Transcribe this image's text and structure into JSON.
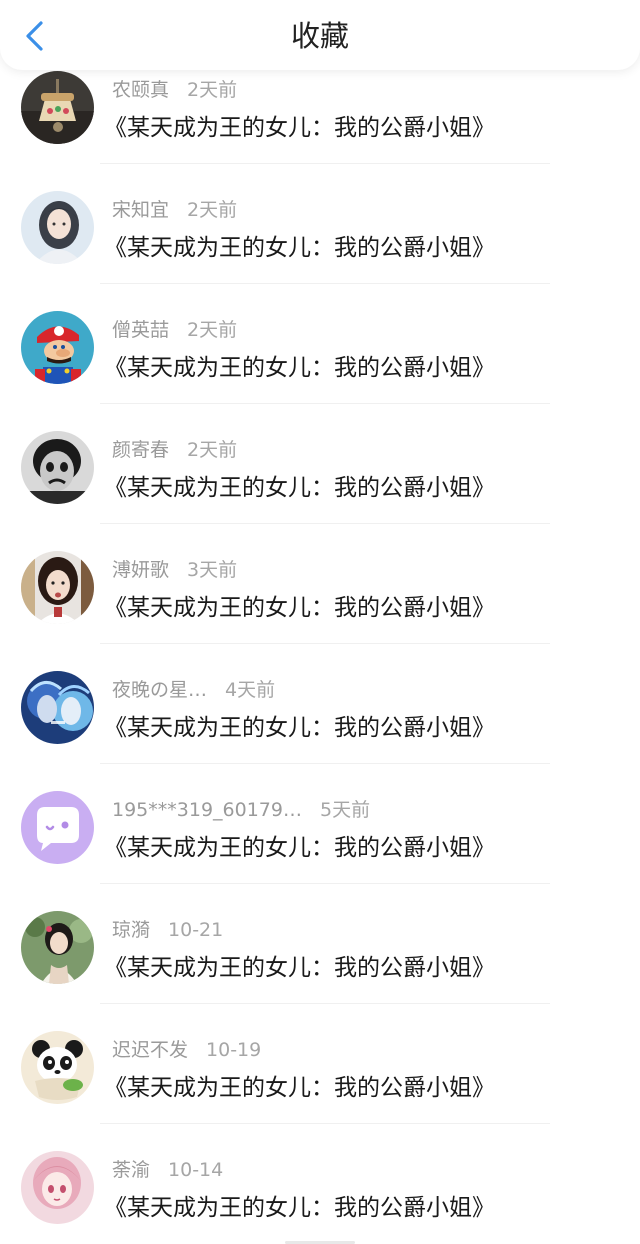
{
  "header": {
    "title": "收藏",
    "back_icon": "chevron-left-icon",
    "accent_color": "#3b8fe8"
  },
  "items": [
    {
      "user": "农颐真",
      "time": "2天前",
      "title": "《某天成为王的女儿：我的公爵小姐》",
      "avatar_icon": "bell-photo-avatar"
    },
    {
      "user": "宋知宜",
      "time": "2天前",
      "title": "《某天成为王的女儿：我的公爵小姐》",
      "avatar_icon": "anime-girl-avatar"
    },
    {
      "user": "僧英喆",
      "time": "2天前",
      "title": "《某天成为王的女儿：我的公爵小姐》",
      "avatar_icon": "mario-avatar"
    },
    {
      "user": "颜寄春",
      "time": "2天前",
      "title": "《某天成为王的女儿：我的公爵小姐》",
      "avatar_icon": "mime-face-avatar"
    },
    {
      "user": "溥妍歌",
      "time": "3天前",
      "title": "《某天成为王的女儿：我的公爵小姐》",
      "avatar_icon": "girl-photo-avatar"
    },
    {
      "user": "夜晚の星…",
      "time": "4天前",
      "title": "《某天成为王的女儿：我的公爵小姐》",
      "avatar_icon": "fantasy-character-avatar"
    },
    {
      "user": "195***319_60179…",
      "time": "5天前",
      "title": "《某天成为王的女儿：我的公爵小姐》",
      "avatar_icon": "chat-bubble-default-avatar"
    },
    {
      "user": "琼漪",
      "time": "10-21",
      "title": "《某天成为王的女儿：我的公爵小姐》",
      "avatar_icon": "hanfu-girl-avatar"
    },
    {
      "user": "迟迟不发",
      "time": "10-19",
      "title": "《某天成为王的女儿：我的公爵小姐》",
      "avatar_icon": "panda-avatar"
    },
    {
      "user": "荼渝",
      "time": "10-14",
      "title": "《某天成为王的女儿：我的公爵小姐》",
      "avatar_icon": "pink-anime-avatar"
    }
  ]
}
